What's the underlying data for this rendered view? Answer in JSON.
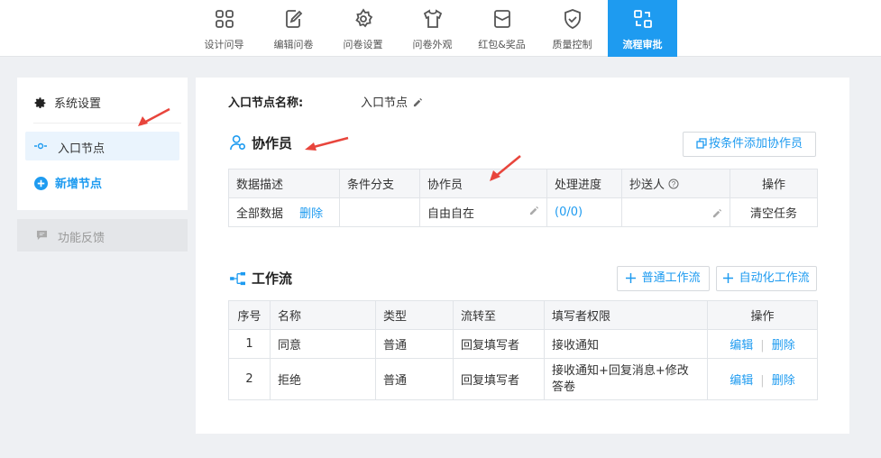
{
  "toolbar": {
    "tabs": [
      {
        "label": "设计问导",
        "icon": "grid-icon"
      },
      {
        "label": "编辑问卷",
        "icon": "edit-form-icon"
      },
      {
        "label": "问卷设置",
        "icon": "gear-icon"
      },
      {
        "label": "问卷外观",
        "icon": "shirt-icon"
      },
      {
        "label": "红包&奖品",
        "icon": "gift-icon"
      },
      {
        "label": "质量控制",
        "icon": "shield-icon"
      },
      {
        "label": "流程审批",
        "icon": "flow-icon",
        "active": true
      }
    ]
  },
  "sidebar": {
    "system_settings": "系统设置",
    "entry_node": "入口节点",
    "add_node": "新增节点",
    "feedback": "功能反馈"
  },
  "main": {
    "entry_label": "入口节点名称:",
    "entry_value": "入口节点",
    "collaborators": {
      "title": "协作员",
      "add_button": "按条件添加协作员",
      "headers": [
        "数据描述",
        "条件分支",
        "协作员",
        "处理进度",
        "抄送人",
        "操作"
      ],
      "row": {
        "data_desc": "全部数据",
        "delete": "删除",
        "branch": "",
        "collaborator": "自由自在",
        "progress": "(0/0)",
        "cc": "",
        "action": "清空任务"
      }
    },
    "workflow": {
      "title": "工作流",
      "btn_normal": "普通工作流",
      "btn_auto": "自动化工作流",
      "headers": [
        "序号",
        "名称",
        "类型",
        "流转至",
        "填写者权限",
        "操作"
      ],
      "rows": [
        {
          "no": "1",
          "name": "同意",
          "type": "普通",
          "to": "回复填写者",
          "perm": "接收通知",
          "edit": "编辑",
          "del": "删除"
        },
        {
          "no": "2",
          "name": "拒绝",
          "type": "普通",
          "to": "回复填写者",
          "perm": "接收通知+回复消息+修改答卷",
          "edit": "编辑",
          "del": "删除"
        }
      ]
    }
  },
  "colors": {
    "accent": "#1e9bf0",
    "annotation": "#e8453c"
  }
}
